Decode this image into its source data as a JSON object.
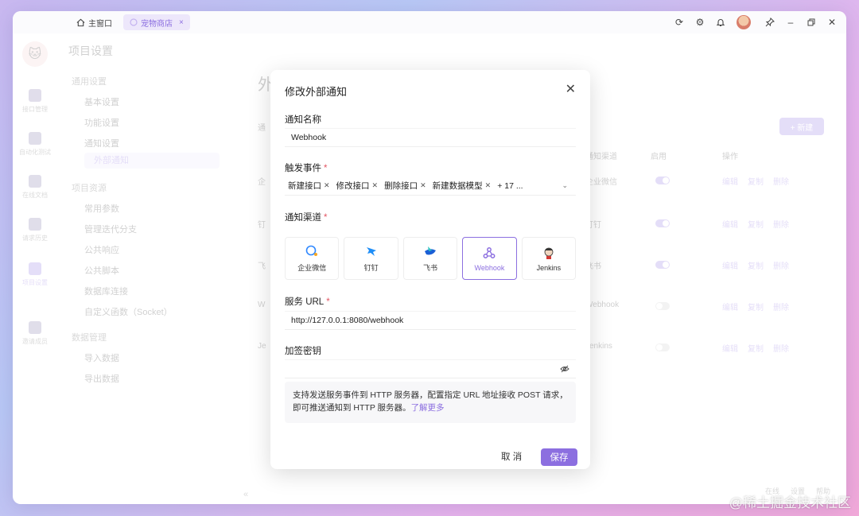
{
  "titlebar": {
    "tabs": [
      {
        "label": "主窗口",
        "icon": "home-icon",
        "active": false
      },
      {
        "label": "宠物商店",
        "icon": "app-icon",
        "active": true
      }
    ]
  },
  "sidebar": {
    "items": [
      {
        "label": "接口管理"
      },
      {
        "label": "自动化测试"
      },
      {
        "label": "在线文档"
      },
      {
        "label": "请求历史"
      },
      {
        "label": "项目设置"
      },
      {
        "label": "邀请成员"
      }
    ]
  },
  "menu": {
    "title": "项目设置",
    "items": [
      {
        "label": "通用设置",
        "group": true
      },
      {
        "label": "基本设置"
      },
      {
        "label": "功能设置"
      },
      {
        "label": "通知设置"
      },
      {
        "label": "外部通知",
        "selected": true
      },
      {
        "label": "项目资源",
        "group": true
      },
      {
        "label": "常用参数"
      },
      {
        "label": "管理迭代分支"
      },
      {
        "label": "公共响应"
      },
      {
        "label": "公共脚本"
      },
      {
        "label": "数据库连接"
      },
      {
        "label": "自定义函数（Socket）"
      },
      {
        "label": "数据管理",
        "group": true
      },
      {
        "label": "导入数据"
      },
      {
        "label": "导出数据"
      }
    ]
  },
  "main": {
    "title": "外部通知",
    "subtitle": "通",
    "new_label": "+ 新建",
    "columns": {
      "channel": "通知渠道",
      "enabled": "启用",
      "ops": "操作"
    },
    "rows": [
      {
        "lead": "企",
        "channel": "企业微信",
        "enabled": true
      },
      {
        "lead": "钉",
        "channel": "钉钉",
        "enabled": true
      },
      {
        "lead": "飞",
        "channel": "飞书",
        "enabled": true
      },
      {
        "lead": "W",
        "channel": "Webhook",
        "enabled": false
      },
      {
        "lead": "Je",
        "channel": "Jenkins",
        "enabled": false
      }
    ],
    "ops": [
      "编辑",
      "复制",
      "删除"
    ],
    "status": [
      "在线",
      "设置",
      "帮助"
    ]
  },
  "modal": {
    "title": "修改外部通知",
    "name_label": "通知名称",
    "name_value": "Webhook",
    "events_label": "触发事件",
    "events": [
      "新建接口",
      "修改接口",
      "删除接口",
      "新建数据模型"
    ],
    "events_more": "+ 17 ...",
    "channel_label": "通知渠道",
    "channels": [
      {
        "label": "企业微信",
        "icon": "wecom-icon"
      },
      {
        "label": "钉钉",
        "icon": "dingtalk-icon"
      },
      {
        "label": "飞书",
        "icon": "feishu-icon"
      },
      {
        "label": "Webhook",
        "icon": "webhook-icon",
        "selected": true
      },
      {
        "label": "Jenkins",
        "icon": "jenkins-icon"
      }
    ],
    "url_label": "服务 URL",
    "url_value": "http://127.0.0.1:8080/webhook",
    "secret_label": "加签密钥",
    "secret_value": "",
    "info_text": "支持发送服务事件到 HTTP 服务器，配置指定 URL 地址接收 POST 请求，即可推送通知到 HTTP 服务器。",
    "info_link": "了解更多",
    "cancel_label": "取 消",
    "save_label": "保存"
  },
  "watermark": "@稀土掘金技术社区",
  "colors": {
    "accent": "#8c6fe0",
    "required": "#e25563"
  }
}
